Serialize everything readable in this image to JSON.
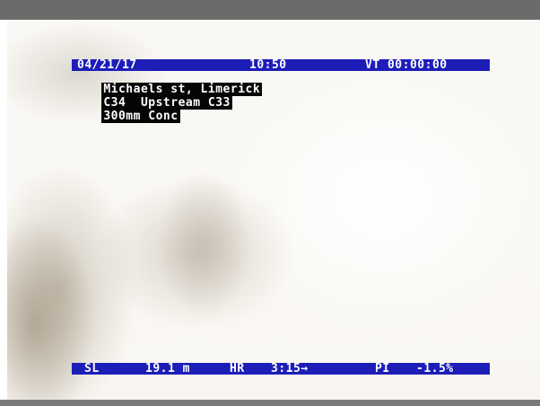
{
  "osd": {
    "date": "04/21/17",
    "time": "10:50",
    "vt": "VT 00:00:00",
    "location": "Michaels st, Limerick",
    "segment": "C34  Upstream C33",
    "pipe": "300mm Conc",
    "sl_label": "SL",
    "sl_value": "19.1 m",
    "hr_label": "HR",
    "hr_value": "3:15→",
    "pi_label": "PI",
    "pi_value": "-1.5%"
  },
  "colors": {
    "osd_band": "#1d1db8",
    "osd_text_bg": "#050505",
    "osd_text": "#ffffff"
  }
}
